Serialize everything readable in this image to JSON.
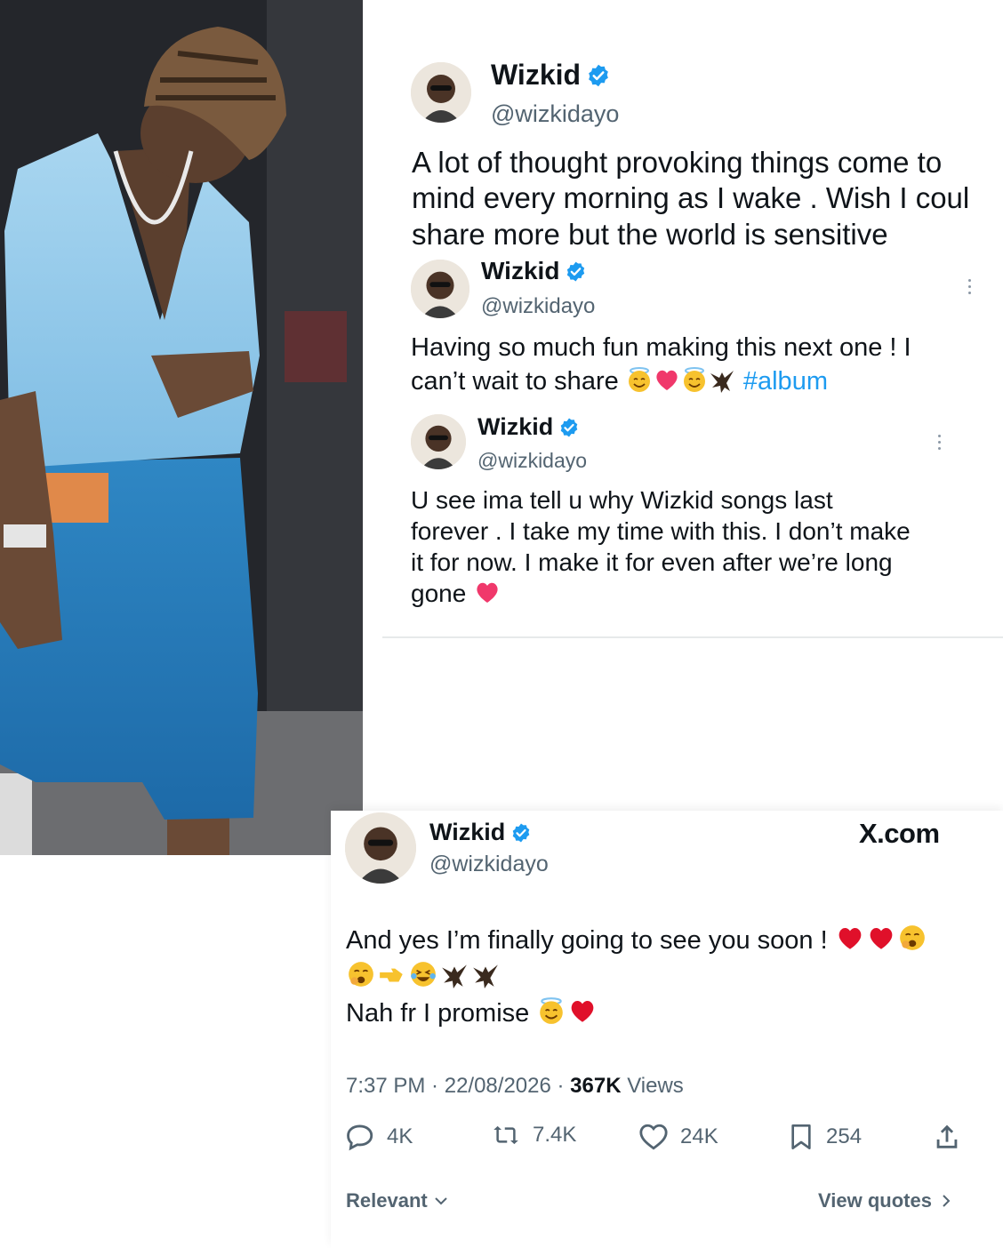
{
  "photo": {
    "alt_icon": "person-photo"
  },
  "tweets": [
    {
      "name": "Wizkid",
      "handle": "@wizkidayo",
      "lines": [
        "A lot of thought provoking things come to",
        "mind every morning as I wake . Wish I coul",
        "share more but the world is sensitive"
      ]
    },
    {
      "name": "Wizkid",
      "handle": "@wizkidayo",
      "lines": [
        "Having so much fun making this next one ! I",
        "can’t wait to share"
      ],
      "hashtag": "#album"
    },
    {
      "name": "Wizkid",
      "handle": "@wizkidayo",
      "lines": [
        "U see ima tell u why Wizkid songs last",
        "forever . I take my time with this. I don’t make",
        "it for now. I make it for even after we’re long",
        "gone"
      ]
    }
  ],
  "main_tweet": {
    "name": "Wizkid",
    "handle": "@wizkidayo",
    "source": "X.com",
    "line1": "And yes I’m finally going to see you soon !",
    "line3": "Nah fr I promise",
    "time": "7:37 PM",
    "date": "22/08/2026",
    "views_count": "367K",
    "views_label": "Views",
    "replies": "4K",
    "reposts": "7.4K",
    "likes": "24K",
    "bookmarks": "254",
    "relevant_label": "Relevant",
    "view_quotes_label": "View quotes"
  },
  "colors": {
    "link": "#1d9bf0",
    "secondary_text": "#536471",
    "verified": "#1d9bf0"
  }
}
